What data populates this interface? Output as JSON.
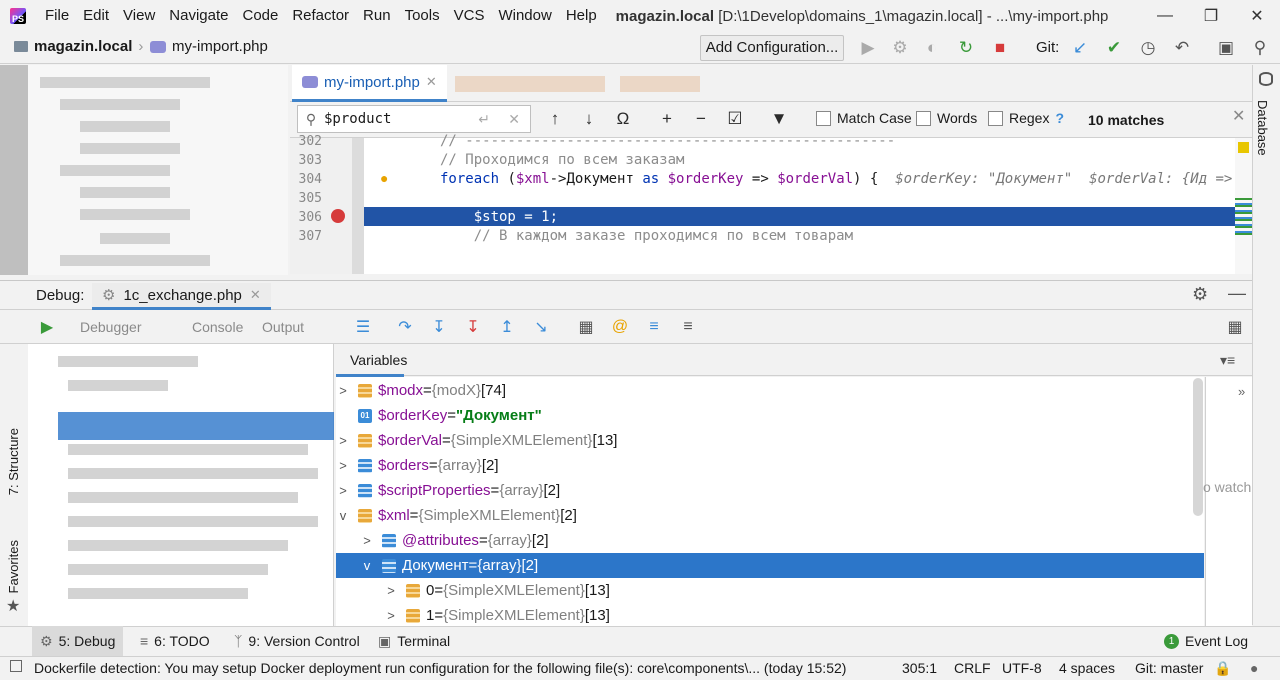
{
  "menu": {
    "items": [
      "File",
      "Edit",
      "View",
      "Navigate",
      "Code",
      "Refactor",
      "Run",
      "Tools",
      "VCS",
      "Window",
      "Help"
    ],
    "project": "magazin.local",
    "path": "[D:\\1Develop\\domains_1\\magazin.local] - ...\\my-import.php"
  },
  "nav": {
    "project": "magazin.local",
    "file": "my-import.php",
    "run_config": "Add Configuration...",
    "git_label": "Git:"
  },
  "editor": {
    "tab": "my-import.php",
    "search_value": "$product",
    "match_case": "Match Case",
    "words": "Words",
    "regex": "Regex",
    "help": "?",
    "matches": "10 matches",
    "lines": [
      {
        "num": "302",
        "text": "// ---------------------------------------------------"
      },
      {
        "num": "303",
        "text": "// Проходимся по всем заказам"
      },
      {
        "num": "304",
        "kw": "foreach",
        "rest1": " (",
        "v1": "$xml",
        "rest2": "->Документ ",
        "kw2": "as",
        "rest3": " ",
        "v2": "$orderKey",
        "rest4": " => ",
        "v3": "$orderVal",
        "rest5": ") {  ",
        "inlay": "$orderKey: \"Документ\"  $orderVal: {Ид =>"
      },
      {
        "num": "305",
        "text": ""
      },
      {
        "num": "306",
        "text": "    $stop = 1;"
      },
      {
        "num": "307",
        "text": "    // В каждом заказе проходимся по всем товарам"
      }
    ],
    "right_label": "Database"
  },
  "debug": {
    "label": "Debug:",
    "tab": "1c_exchange.php",
    "tabs_blurred": [
      "Debugger",
      "Console",
      "Output"
    ],
    "variables_label": "Variables",
    "watch_hint": "o watch",
    "vars": [
      {
        "arrow": ">",
        "icon": "obj",
        "name": "$modx",
        "eq": " = ",
        "type": "{modX}",
        "extra": " [74]",
        "indent": 0
      },
      {
        "arrow": "",
        "icon": "str",
        "name": "$orderKey",
        "eq": " = ",
        "str": "\"Документ\"",
        "indent": 0
      },
      {
        "arrow": ">",
        "icon": "obj",
        "name": "$orderVal",
        "eq": " = ",
        "type": "{SimpleXMLElement}",
        "extra": " [13]",
        "indent": 0
      },
      {
        "arrow": ">",
        "icon": "arr",
        "name": "$orders",
        "eq": " = ",
        "type": "{array}",
        "extra": " [2]",
        "indent": 0
      },
      {
        "arrow": ">",
        "icon": "arr",
        "name": "$scriptProperties",
        "eq": " = ",
        "type": "{array}",
        "extra": " [2]",
        "indent": 0
      },
      {
        "arrow": "v",
        "icon": "obj",
        "name": "$xml",
        "eq": " = ",
        "type": "{SimpleXMLElement}",
        "extra": " [2]",
        "indent": 0
      },
      {
        "arrow": ">",
        "icon": "arr",
        "name": "@attributes",
        "eq": " = ",
        "type": "{array}",
        "extra": " [2]",
        "indent": 1
      },
      {
        "arrow": "v",
        "icon": "arr",
        "name": "Документ",
        "eq": " = ",
        "type": "{array}",
        "extra": " [2]",
        "indent": 1,
        "selected": true
      },
      {
        "arrow": ">",
        "icon": "obj",
        "name": "0",
        "eq": " = ",
        "type": "{SimpleXMLElement}",
        "extra": " [13]",
        "indent": 2
      },
      {
        "arrow": ">",
        "icon": "obj",
        "name": "1",
        "eq": " = ",
        "type": "{SimpleXMLElement}",
        "extra": " [13]",
        "indent": 2
      }
    ]
  },
  "left_strip": {
    "structure": "7: Structure",
    "favorites": "Favorites"
  },
  "bottom_tabs": {
    "debug": "5: Debug",
    "todo": "6: TODO",
    "vcs": "9: Version Control",
    "terminal": "Terminal",
    "event_log": "Event Log",
    "event_count": "1"
  },
  "status": {
    "message": "Dockerfile detection: You may setup Docker deployment run configuration for the following file(s): core\\components\\... (today 15:52)",
    "position": "305:1",
    "line_sep": "CRLF",
    "encoding": "UTF-8",
    "indent": "4 spaces",
    "branch": "Git: master"
  },
  "colors": {
    "accent": "#2c76c9",
    "keyword": "#0033b3",
    "variable": "#871094",
    "string": "#067d17"
  }
}
